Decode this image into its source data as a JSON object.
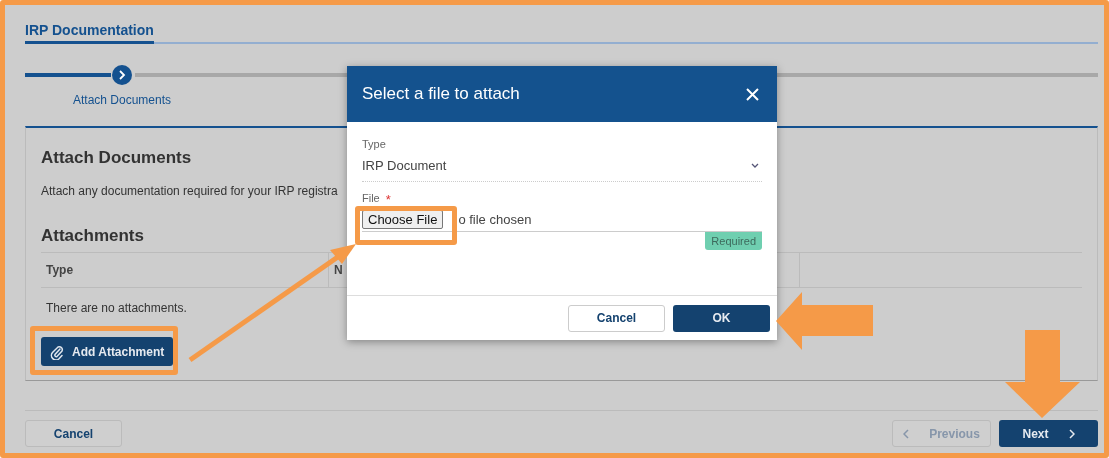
{
  "page": {
    "title": "IRP Documentation"
  },
  "steps": [
    {
      "label": "Attach Documents",
      "selected": true
    }
  ],
  "card": {
    "heading": "Attach Documents",
    "description": "Attach any documentation required for your IRP registra",
    "attachments_heading": "Attachments",
    "columns": [
      "Type",
      "N"
    ],
    "empty_text": "There are no attachments.",
    "add_button": "Add Attachment"
  },
  "footer": {
    "cancel": "Cancel",
    "previous": {
      "label": "Previous",
      "disabled": true
    },
    "next": {
      "label": "Next",
      "disabled": false
    }
  },
  "dialog": {
    "title": "Select a file to attach",
    "type_label": "Type",
    "type_value": "IRP Document",
    "file_label": "File",
    "required_mark": "*",
    "choose_button": "Choose File",
    "file_status": "o file chosen",
    "validation": "Required",
    "cancel": "Cancel",
    "ok": "OK"
  }
}
